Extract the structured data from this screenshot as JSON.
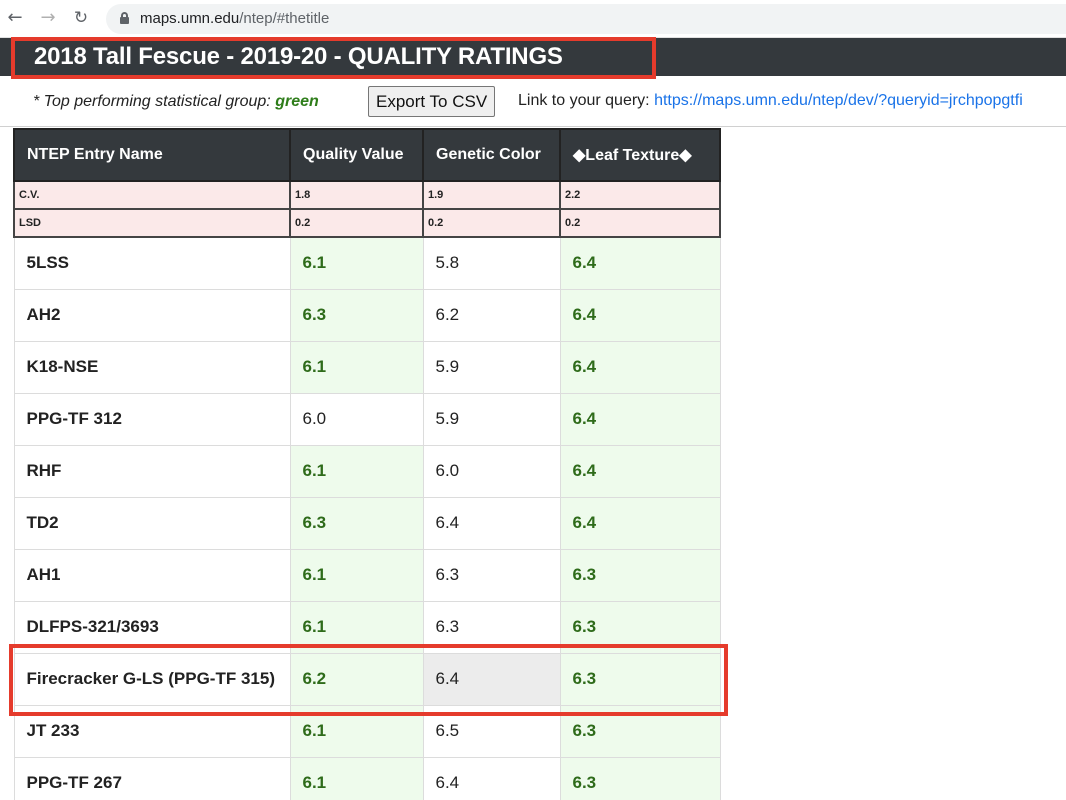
{
  "browser": {
    "url_host": "maps.umn.edu",
    "url_path": "/ntep/#thetitle"
  },
  "page": {
    "title": "2018 Tall Fescue - 2019-20 - QUALITY RATINGS"
  },
  "controls": {
    "legend_prefix": "* Top performing statistical group: ",
    "legend_color_word": "green",
    "export_label": "Export To CSV",
    "query_label": "Link to your query: ",
    "query_link": "https://maps.umn.edu/ntep/dev/?queryid=jrchpopgtfi"
  },
  "colors": {
    "title_bar": "#34393d",
    "highlight_outline": "#e53b2c",
    "top_group_text": "#2e6b1a",
    "top_group_bg": "#eefbec",
    "stat_row_bg": "#fbe9e9"
  },
  "table": {
    "headers": [
      "NTEP Entry Name",
      "Quality Value",
      "Genetic Color",
      "◆Leaf Texture◆"
    ],
    "stats": [
      {
        "label": "C.V.",
        "values": [
          "1.8",
          "1.9",
          "2.2"
        ]
      },
      {
        "label": "LSD",
        "values": [
          "0.2",
          "0.2",
          "0.2"
        ]
      }
    ],
    "rows": [
      {
        "name": "5LSS",
        "quality": "6.1",
        "color": "5.8",
        "texture": "6.4",
        "quality_top": true,
        "color_top": false,
        "texture_top": true
      },
      {
        "name": "AH2",
        "quality": "6.3",
        "color": "6.2",
        "texture": "6.4",
        "quality_top": true,
        "color_top": false,
        "texture_top": true
      },
      {
        "name": "K18-NSE",
        "quality": "6.1",
        "color": "5.9",
        "texture": "6.4",
        "quality_top": true,
        "color_top": false,
        "texture_top": true
      },
      {
        "name": "PPG-TF 312",
        "quality": "6.0",
        "color": "5.9",
        "texture": "6.4",
        "quality_top": false,
        "color_top": false,
        "texture_top": true
      },
      {
        "name": "RHF",
        "quality": "6.1",
        "color": "6.0",
        "texture": "6.4",
        "quality_top": true,
        "color_top": false,
        "texture_top": true
      },
      {
        "name": "TD2",
        "quality": "6.3",
        "color": "6.4",
        "texture": "6.4",
        "quality_top": true,
        "color_top": false,
        "texture_top": true
      },
      {
        "name": "AH1",
        "quality": "6.1",
        "color": "6.3",
        "texture": "6.3",
        "quality_top": true,
        "color_top": false,
        "texture_top": true
      },
      {
        "name": "DLFPS-321/3693",
        "quality": "6.1",
        "color": "6.3",
        "texture": "6.3",
        "quality_top": true,
        "color_top": false,
        "texture_top": true
      },
      {
        "name": "Firecracker G-LS (PPG-TF 315)",
        "quality": "6.2",
        "color": "6.4",
        "texture": "6.3",
        "quality_top": true,
        "color_top": false,
        "texture_top": true,
        "highlighted": true
      },
      {
        "name": "JT 233",
        "quality": "6.1",
        "color": "6.5",
        "texture": "6.3",
        "quality_top": true,
        "color_top": false,
        "texture_top": true
      },
      {
        "name": "PPG-TF 267",
        "quality": "6.1",
        "color": "6.4",
        "texture": "6.3",
        "quality_top": true,
        "color_top": false,
        "texture_top": true
      }
    ]
  }
}
